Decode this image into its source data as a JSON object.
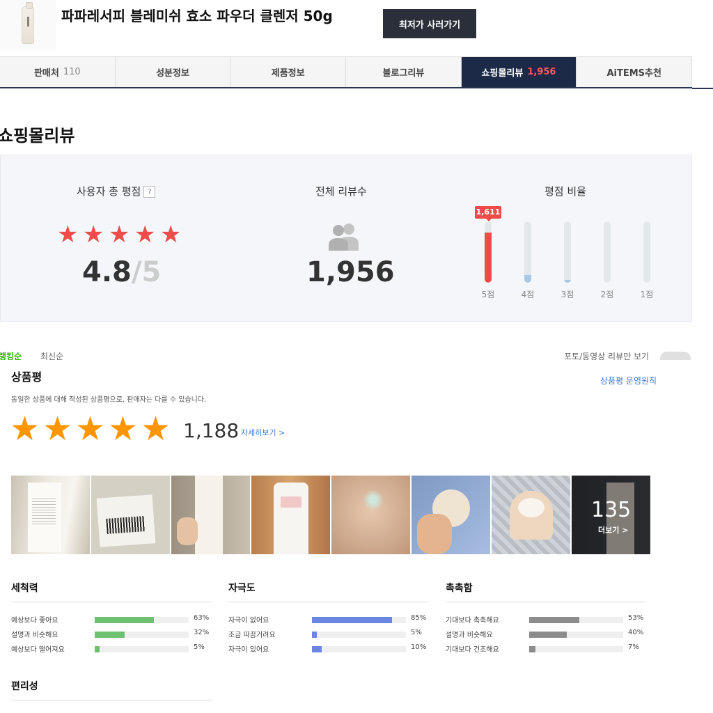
{
  "header": {
    "product_title": "파파레서피 블레미쉬 효소 파우더 클렌저 50g",
    "buy_button": "최저가 사러가기"
  },
  "tabs": [
    {
      "label": "판매처",
      "count": "110",
      "active": false
    },
    {
      "label": "성분정보",
      "count": "",
      "active": false
    },
    {
      "label": "제품정보",
      "count": "",
      "active": false
    },
    {
      "label": "블로그리뷰",
      "count": "",
      "active": false
    },
    {
      "label": "쇼핑몰리뷰",
      "count": "1,956",
      "active": true
    },
    {
      "label": "AiTEMS추천",
      "count": "",
      "active": false
    }
  ],
  "section_title": "쇼핑몰리뷰",
  "summary": {
    "avg_label": "사용자 총 평점",
    "help_icon": "?",
    "avg_score": "4.8",
    "avg_max": "/5",
    "avg_value": 4.8,
    "total_label": "전체 리뷰수",
    "total_count": "1,956",
    "ratio_label": "평점 비율",
    "ratio_bubble": "1,611",
    "ratio": [
      {
        "label": "5점",
        "fraction": 0.82,
        "color": "#ef4b4b"
      },
      {
        "label": "4점",
        "fraction": 0.12,
        "color": "#a9c8e6"
      },
      {
        "label": "3점",
        "fraction": 0.04,
        "color": "#a9c8e6"
      },
      {
        "label": "2점",
        "fraction": 0.0,
        "color": "#a9c8e6"
      },
      {
        "label": "1점",
        "fraction": 0.0,
        "color": "#a9c8e6"
      }
    ]
  },
  "cut_strip": {
    "left_a": "랭킹순",
    "left_b": "최신순",
    "right": "포토/동영상 리뷰만 보기"
  },
  "review": {
    "title": "상품평",
    "policy_link": "상품평 운영원칙",
    "description": "동일한 상품에 대해 작성된 상품평으로, 판매자는 다를 수 있습니다.",
    "stars": 5,
    "count": "1,188",
    "detail_link": "자세히보기 >",
    "more_count": "135",
    "more_label": "더보기 >"
  },
  "stats": [
    {
      "title": "세척력",
      "color": "#6cc070",
      "rows": [
        {
          "label": "예상보다 좋아요",
          "pct": "63%",
          "value": 63
        },
        {
          "label": "설명과 비슷해요",
          "pct": "32%",
          "value": 32
        },
        {
          "label": "예상보다 떨어져요",
          "pct": "5%",
          "value": 5
        }
      ]
    },
    {
      "title": "자극도",
      "color": "#6b86e0",
      "rows": [
        {
          "label": "자극이 없어요",
          "pct": "85%",
          "value": 85
        },
        {
          "label": "조금 따끔거려요",
          "pct": "5%",
          "value": 5
        },
        {
          "label": "자극이 있어요",
          "pct": "10%",
          "value": 10
        }
      ]
    },
    {
      "title": "촉촉함",
      "color": "#8c8c8c",
      "rows": [
        {
          "label": "기대보다 촉촉해요",
          "pct": "53%",
          "value": 53
        },
        {
          "label": "설명과 비슷해요",
          "pct": "40%",
          "value": 40
        },
        {
          "label": "기대보다 건조해요",
          "pct": "7%",
          "value": 7
        }
      ]
    },
    {
      "title": "편리성",
      "color": "#8c8c8c",
      "rows": []
    }
  ],
  "colors": {
    "accent_red": "#ef4b4b",
    "star_orange": "#ff9500",
    "nav_dark": "#1c2a48",
    "link_blue": "#3a7bd5"
  }
}
